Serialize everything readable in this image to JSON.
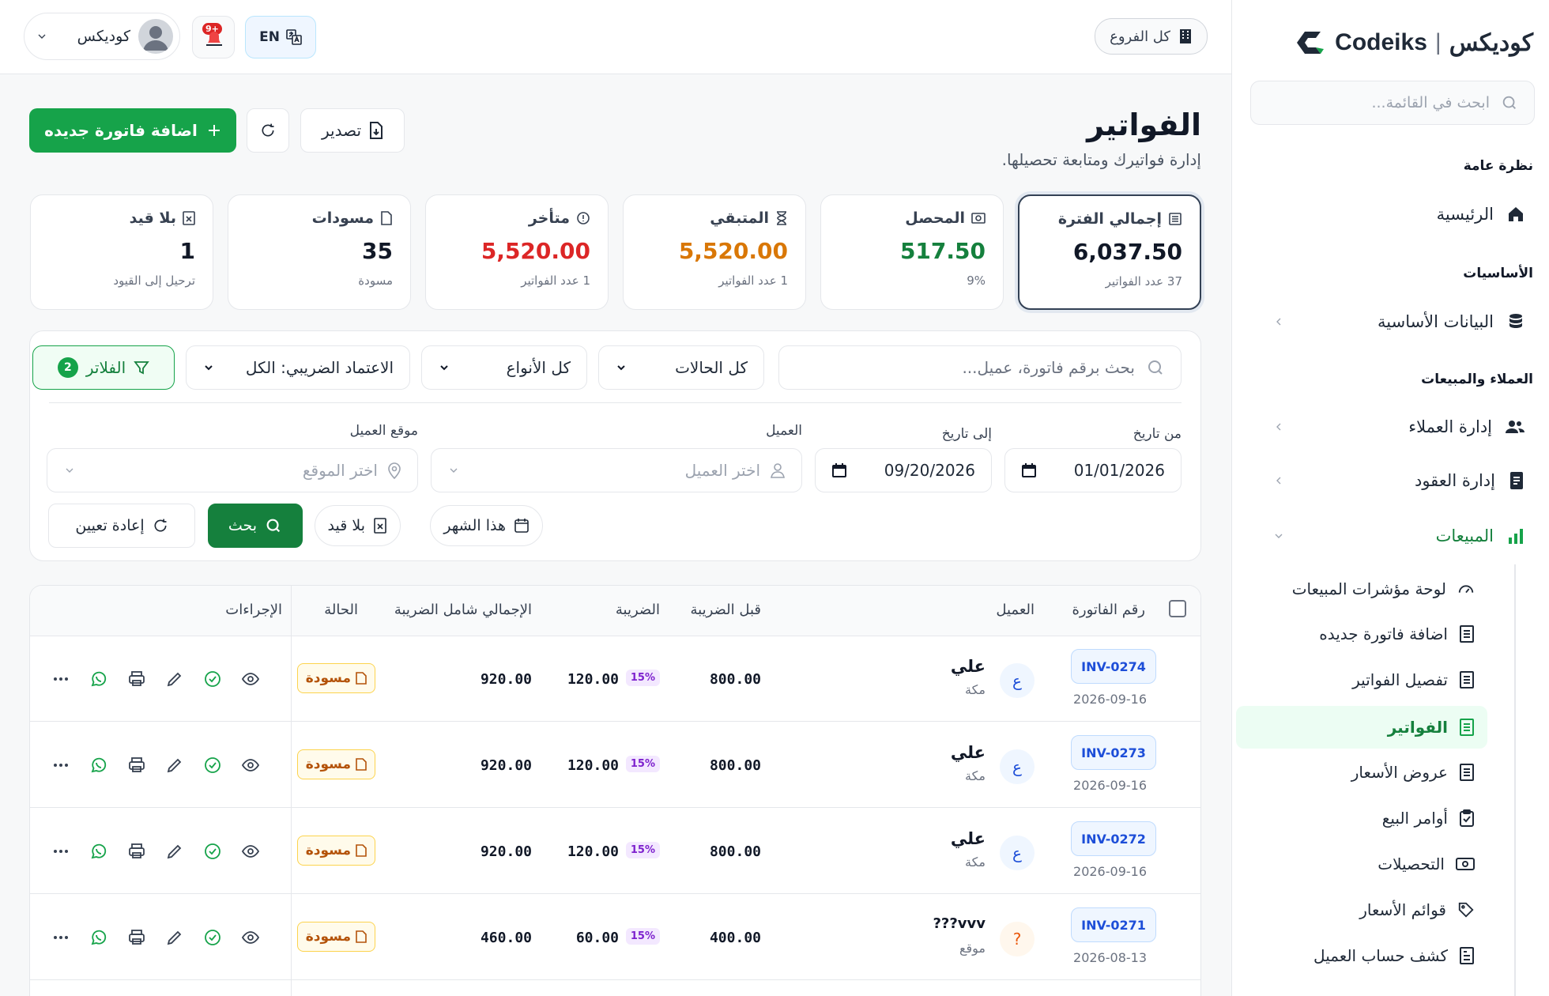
{
  "brand": {
    "name_ar": "كوديكس",
    "name_en": "Codeiks",
    "divider": "|"
  },
  "sidebar": {
    "search_placeholder": "ابحث في القائمة...",
    "sections": [
      {
        "title": "نظرة عامة"
      },
      {
        "title": "الأساسيات"
      },
      {
        "title": "العملاء والمبيعات"
      }
    ],
    "items": {
      "home": "الرئيسية",
      "basic_data": "البيانات الأساسية",
      "customers": "إدارة العملاء",
      "contracts": "إدارة العقود",
      "sales": "المبيعات"
    },
    "sub_items": [
      {
        "label": "لوحة مؤشرات المبيعات",
        "icon": "gauge-icon"
      },
      {
        "label": "اضافة فاتورة جديده",
        "icon": "invoice-icon"
      },
      {
        "label": "تفصيل الفواتير",
        "icon": "invoice-icon"
      },
      {
        "label": "الفواتير",
        "icon": "invoice-icon"
      },
      {
        "label": "عروض الأسعار",
        "icon": "invoice-icon"
      },
      {
        "label": "أوامر البيع",
        "icon": "clipboard-icon"
      },
      {
        "label": "التحصيلات",
        "icon": "cash-icon"
      },
      {
        "label": "قوائم الأسعار",
        "icon": "tag-icon"
      },
      {
        "label": "كشف حساب العميل",
        "icon": "statement-icon"
      }
    ]
  },
  "topbar": {
    "branch": "كل الفروع",
    "lang": "EN",
    "notif_badge": "+9",
    "user": "كوديكس"
  },
  "page": {
    "title": "الفواتير",
    "subtitle": "إدارة فواتيرك ومتابعة تحصيلها.",
    "add_button": "اضافة فاتورة جديده",
    "export_button": "تصدير"
  },
  "stats": [
    {
      "label": "إجمالي الفترة",
      "value": "6,037.50",
      "note": "37 عدد الفواتير",
      "color": "#111827"
    },
    {
      "label": "المحصل",
      "value": "517.50",
      "note": "9%",
      "color": "#15803d"
    },
    {
      "label": "المتبقي",
      "value": "5,520.00",
      "note": "1 عدد الفواتير",
      "color": "#d97706"
    },
    {
      "label": "متأخر",
      "value": "5,520.00",
      "note": "1 عدد الفواتير",
      "color": "#dc2626"
    },
    {
      "label": "مسودات",
      "value": "35",
      "note": "مسودة",
      "color": "#111827"
    },
    {
      "label": "بلا قيد",
      "value": "1",
      "note": "ترحيل إلى القيود",
      "color": "#111827"
    }
  ],
  "filters": {
    "search_placeholder": "بحث برقم فاتورة، عميل...",
    "status": "كل الحالات",
    "types": "كل الأنواع",
    "tax": "الاعتماد الضريبي: الكل",
    "filters_btn": "الفلاتر",
    "filters_count": "2",
    "from_label": "من تاريخ",
    "from_value": "01/01/2026",
    "to_label": "إلى تاريخ",
    "to_value": "09/20/2026",
    "customer_label": "العميل",
    "customer_placeholder": "اختر العميل",
    "location_label": "موقع العميل",
    "location_placeholder": "اختر الموقع",
    "this_month": "هذا الشهر",
    "no_entry": "بلا قيد",
    "search_btn": "بحث",
    "reset_btn": "إعادة تعيين"
  },
  "table": {
    "headers": {
      "invoice_no": "رقم الفاتورة",
      "customer": "العميل",
      "before_tax": "قبل الضريبة",
      "tax": "الضريبة",
      "total": "الإجمالي شامل الضريبة",
      "status": "الحالة",
      "actions": "الإجراءات"
    },
    "rows": [
      {
        "invoice": "INV-0274",
        "date": "2026-09-16",
        "initial": "ع",
        "customer": "علي",
        "city": "مكة",
        "before_tax": "800.00",
        "tax_rate": "15%",
        "tax": "120.00",
        "total": "920.00",
        "status": "مسودة"
      },
      {
        "invoice": "INV-0273",
        "date": "2026-09-16",
        "initial": "ع",
        "customer": "علي",
        "city": "مكة",
        "before_tax": "800.00",
        "tax_rate": "15%",
        "tax": "120.00",
        "total": "920.00",
        "status": "مسودة"
      },
      {
        "invoice": "INV-0272",
        "date": "2026-09-16",
        "initial": "ع",
        "customer": "علي",
        "city": "مكة",
        "before_tax": "800.00",
        "tax_rate": "15%",
        "tax": "120.00",
        "total": "920.00",
        "status": "مسودة"
      },
      {
        "invoice": "INV-0271",
        "date": "2026-08-13",
        "initial": "?",
        "customer": "vvv???",
        "city": "موقع",
        "before_tax": "400.00",
        "tax_rate": "15%",
        "tax": "60.00",
        "total": "460.00",
        "status": "مسودة"
      }
    ]
  }
}
